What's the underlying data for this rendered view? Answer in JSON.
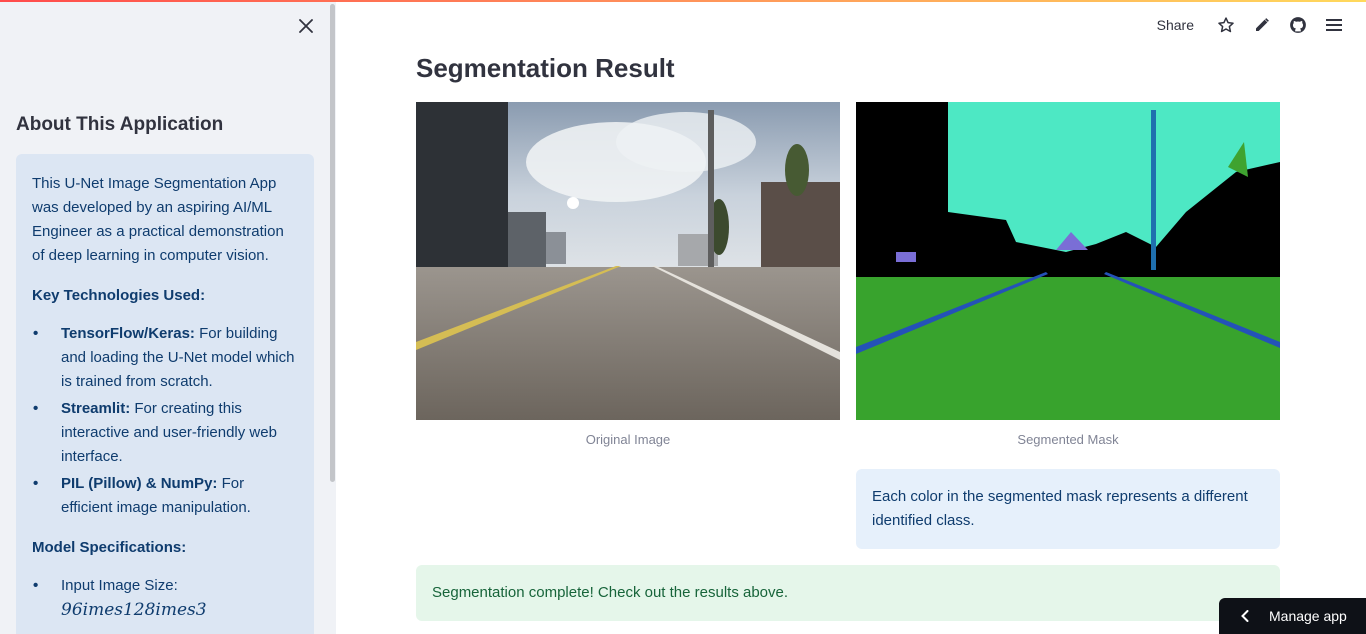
{
  "sidebar": {
    "heading": "About This Application",
    "intro": "This U-Net Image Segmentation App was developed by an aspiring AI/ML Engineer as a practical demonstration of deep learning in computer vision.",
    "tech_heading": "Key Technologies Used:",
    "technologies": [
      {
        "name": "TensorFlow/Keras:",
        "desc": " For building and loading the U-Net model which is trained from scratch."
      },
      {
        "name": "Streamlit:",
        "desc": " For creating this interactive and user-friendly web interface."
      },
      {
        "name": "PIL (Pillow) & NumPy:",
        "desc": " For efficient image manipulation."
      }
    ],
    "specs_heading": "Model Specifications:",
    "specs": [
      {
        "label": "Input Image Size:",
        "math": "96imes128imes3"
      }
    ]
  },
  "toolbar": {
    "share_label": "Share",
    "icons": [
      "star-icon",
      "pencil-icon",
      "github-icon",
      "menu-icon"
    ]
  },
  "main": {
    "title": "Segmentation Result",
    "original_caption": "Original Image",
    "mask_caption": "Segmented Mask",
    "mask_note": "Each color in the segmented mask represents a different identified class.",
    "success_message": "Segmentation complete! Check out the results above."
  },
  "manage_app": {
    "label": "Manage app"
  },
  "colors": {
    "accent": "#ff4b4b",
    "sidebar_bg": "#f0f2f6",
    "info_bg": "#dce6f3",
    "success_bg": "#e5f6ea",
    "mask_green": "#38a32d",
    "mask_cyan": "#4de8c4"
  }
}
